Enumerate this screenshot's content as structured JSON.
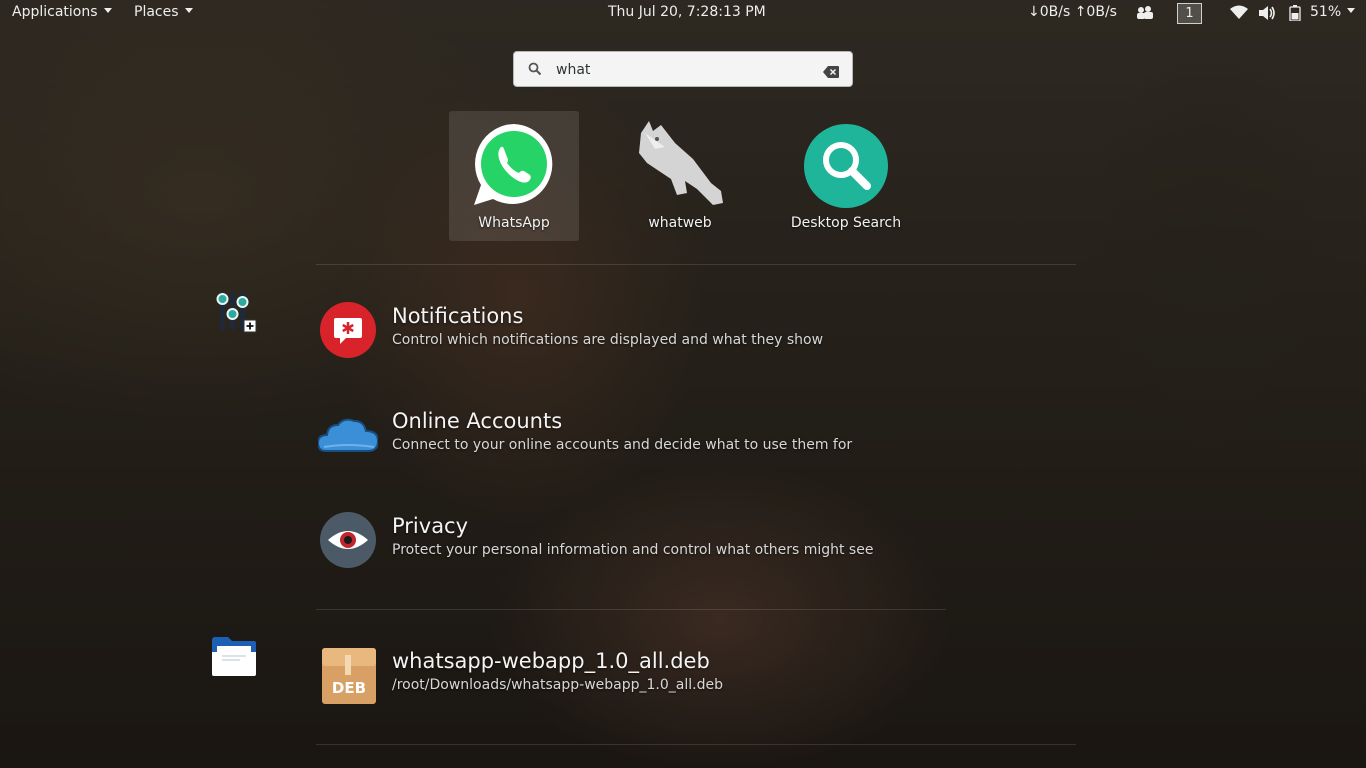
{
  "topbar": {
    "applications": "Applications",
    "places": "Places",
    "clock": "Thu Jul 20,  7:28:13 PM",
    "netspeed": "↓0B/s ↑0B/s",
    "workspace": "1",
    "battery": "51%"
  },
  "search": {
    "value": "what"
  },
  "apps": [
    {
      "label": "WhatsApp"
    },
    {
      "label": "whatweb"
    },
    {
      "label": "Desktop Search"
    }
  ],
  "results": [
    {
      "title": "Notifications",
      "desc": "Control which notifications are displayed and what they show"
    },
    {
      "title": "Online Accounts",
      "desc": "Connect to your online accounts and decide what to use them for"
    },
    {
      "title": "Privacy",
      "desc": "Protect your personal information and control what others might see"
    },
    {
      "title": "whatsapp-webapp_1.0_all.deb",
      "desc": "/root/Downloads/whatsapp-webapp_1.0_all.deb",
      "icon_text": "DEB"
    }
  ],
  "colors": {
    "whatsapp": "#25d366",
    "desktop_search": "#1fb59b",
    "notifications": "#d9232a",
    "cloud": "#3b8fd6",
    "privacy": "#4b5a66",
    "deb": "#d9a066"
  }
}
